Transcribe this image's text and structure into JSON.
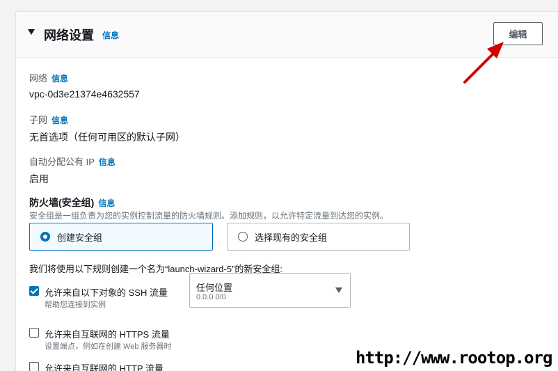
{
  "header": {
    "title": "网络设置",
    "info": "信息",
    "edit_label": "编辑"
  },
  "network": {
    "label": "网络",
    "info": "信息",
    "value": "vpc-0d3e21374e4632557"
  },
  "subnet": {
    "label": "子网",
    "info": "信息",
    "value": "无首选项（任何可用区的默认子网）"
  },
  "public_ip": {
    "label": "自动分配公有 IP",
    "info": "信息",
    "value": "启用"
  },
  "firewall": {
    "label": "防火墙(安全组)",
    "info": "信息",
    "description": "安全组是一组负责为您的实例控制流量的防火墙规则。添加规则，以允许特定流量到达您的实例。",
    "options": [
      {
        "label": "创建安全组",
        "selected": true
      },
      {
        "label": "选择现有的安全组",
        "selected": false
      }
    ],
    "rule_intro": "我们将使用以下规则创建一个名为“launch-wizard-5”的新安全组:"
  },
  "rules": [
    {
      "label": "允许来自以下对象的 SSH 流量",
      "description": "帮助您连接到实例",
      "checked": true
    },
    {
      "label": "允许来自互联网的 HTTPS 流量",
      "description": "设置端点，例如在创建 Web 服务器时",
      "checked": false
    },
    {
      "label": "允许来自互联网的 HTTP 流量",
      "checked": false
    }
  ],
  "ssh_source": {
    "value": "任何位置",
    "sub": "0.0.0.0/0"
  },
  "watermark": "http://www.rootop.org",
  "colors": {
    "accent": "#0073bb",
    "annotation_arrow": "#d40000"
  }
}
